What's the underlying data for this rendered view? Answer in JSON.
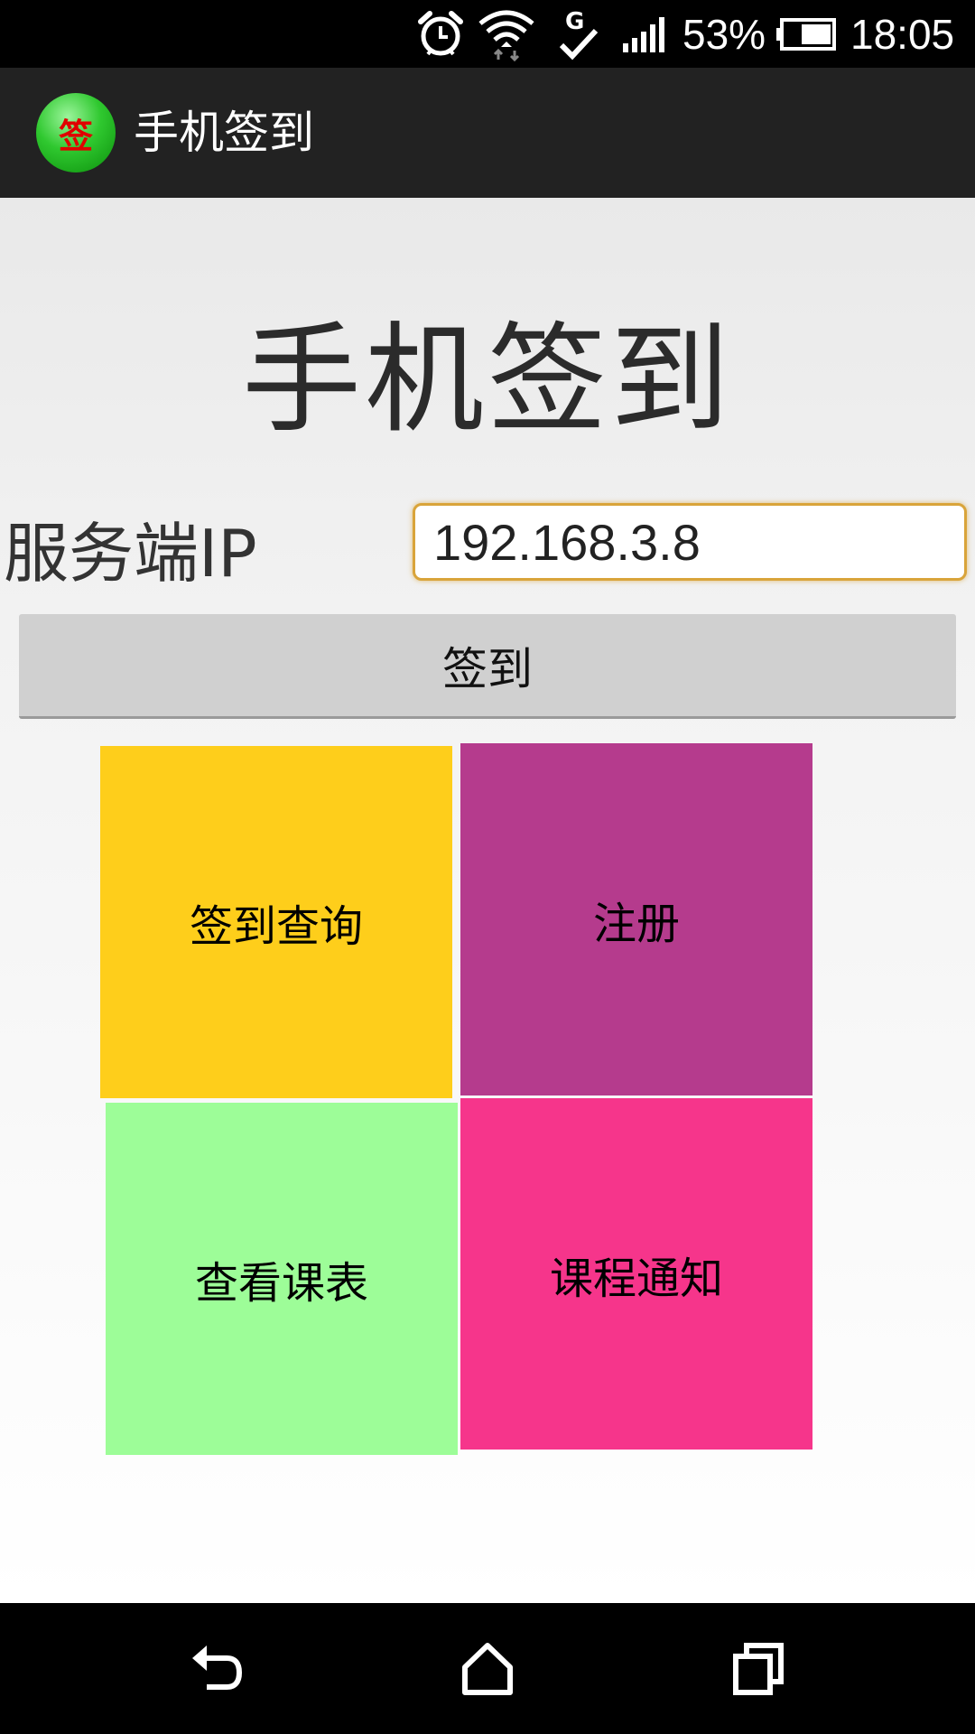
{
  "status_bar": {
    "battery_percent": "53%",
    "time": "18:05",
    "icons": [
      "alarm-icon",
      "wifi-icon",
      "g-sync-icon",
      "signal-icon",
      "battery-icon"
    ]
  },
  "action_bar": {
    "app_icon_text": "签",
    "title": "手机签到"
  },
  "main": {
    "heading": "手机签到",
    "ip_label": "服务端IP",
    "ip_value": "192.168.3.8",
    "sign_button": "签到",
    "tiles": [
      {
        "label": "签到查询",
        "color": "#fece1b"
      },
      {
        "label": "注册",
        "color": "#b53b8d"
      },
      {
        "label": "查看课表",
        "color": "#9dfd98"
      },
      {
        "label": "课程通知",
        "color": "#f6358b"
      }
    ]
  },
  "nav_bar": {
    "buttons": [
      "back-icon",
      "home-icon",
      "recents-icon"
    ]
  }
}
